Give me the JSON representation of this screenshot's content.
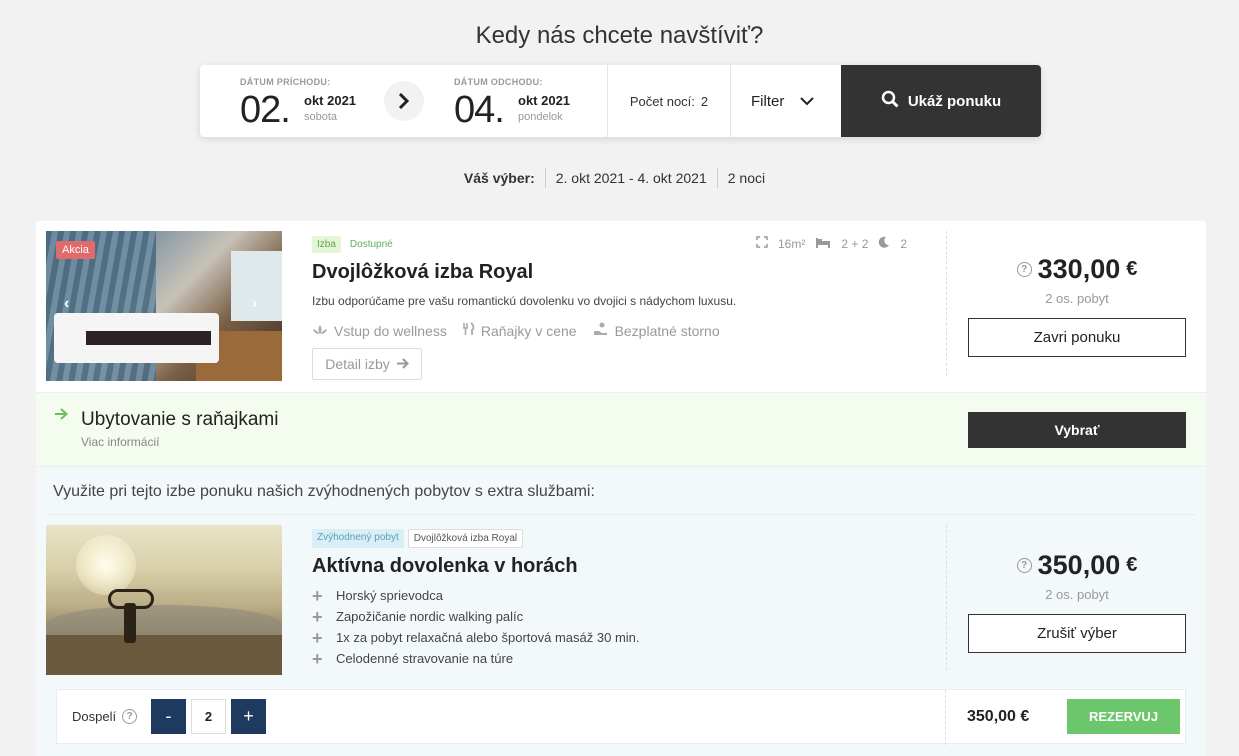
{
  "header": {
    "title": "Kedy nás chcete navštíviť?"
  },
  "search": {
    "arrival": {
      "label": "DÁTUM PRÍCHODU:",
      "day": "02.",
      "month": "okt 2021",
      "weekday": "sobota"
    },
    "departure": {
      "label": "DÁTUM ODCHODU:",
      "day": "04.",
      "month": "okt 2021",
      "weekday": "pondelok"
    },
    "nights_label": "Počet nocí:",
    "nights_value": "2",
    "filter_label": "Filter",
    "button_label": "Ukáž ponuku"
  },
  "selection": {
    "label": "Váš výber:",
    "dates": "2. okt 2021 - 4. okt 2021",
    "nights": "2 noci"
  },
  "room": {
    "badge": "Akcia",
    "tag_type": "Izba",
    "tag_status": "Dostupné",
    "area": "16m²",
    "beds": "2 + 2",
    "nights": "2",
    "title": "Dvojlôžková izba Royal",
    "description": "Izbu odporúčame pre vašu romantickú dovolenku vo dvojici s nádychom luxusu.",
    "amenities": [
      "Vstup do wellness",
      "Raňajky v cene",
      "Bezplatné storno"
    ],
    "detail_button": "Detail izby",
    "price": "330,00",
    "currency": "€",
    "price_note": "2 os. pobyt",
    "close_button": "Zavri ponuku"
  },
  "board": {
    "title": "Ubytovanie s raňajkami",
    "more": "Viac informácií",
    "select_button": "Vybrať"
  },
  "packages": {
    "intro": "Využite pri tejto izbe ponuku našich zvýhodnených pobytov s extra službami:",
    "item": {
      "tag_type": "Zvýhodnený pobyt",
      "tag_room": "Dvojlôžková izba Royal",
      "title": "Aktívna dovolenka v horách",
      "features": [
        "Horský sprievodca",
        "Zapožičanie nordic walking palíc",
        "1x za pobyt relaxačná alebo športová masáž 30 min.",
        "Celodenné stravovanie na túre"
      ],
      "price": "350,00",
      "currency": "€",
      "price_note": "2 os. pobyt",
      "cancel_button": "Zrušiť výber"
    }
  },
  "booking": {
    "adults_label": "Dospelí",
    "minus": "-",
    "plus": "+",
    "adults_value": "2",
    "total": "350,00 €",
    "reserve_button": "REZERVUJ"
  }
}
